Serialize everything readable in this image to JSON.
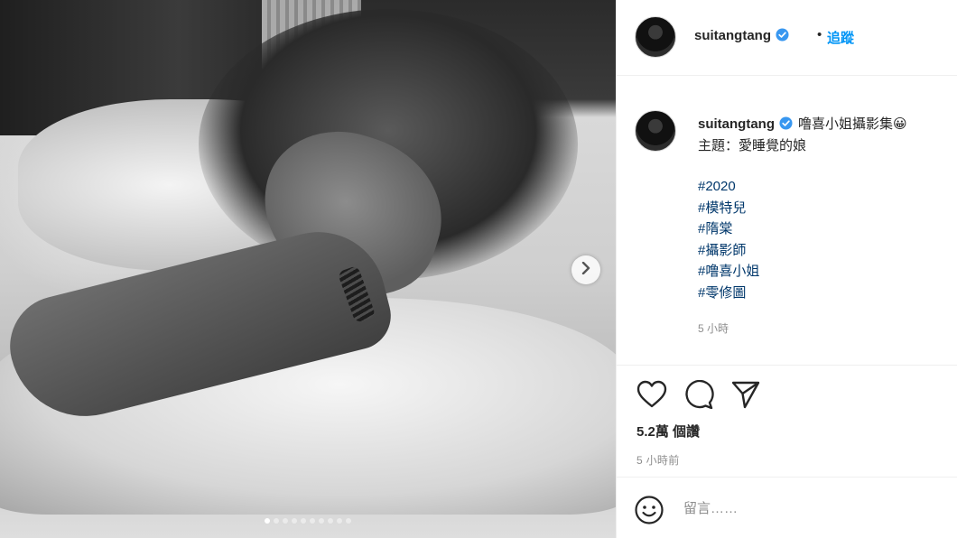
{
  "post": {
    "username": "suitangtang",
    "follow_separator": "•",
    "follow_label": "追蹤",
    "carousel_count": 10,
    "carousel_active_index": 0
  },
  "caption": {
    "username": "suitangtang",
    "title": "噜喜小姐攝影集😀",
    "theme": "主題：愛睡覺的娘",
    "hashtags": [
      "#2020",
      "#模特兒",
      "#隋棠",
      "#攝影師",
      "#噜喜小姐",
      "#零修圖"
    ],
    "time": "5 小時"
  },
  "engagement": {
    "likes": "5.2萬 個讚",
    "time_ago": "5 小時前"
  },
  "comment_box": {
    "placeholder": "留言……"
  },
  "icons": {
    "verified": "verified-badge-icon",
    "like": "heart-icon",
    "comment": "comment-bubble-icon",
    "share": "paper-plane-icon",
    "emoji": "smiley-icon",
    "next": "chevron-right-icon"
  },
  "colors": {
    "accent_blue": "#0095f6",
    "verified_blue": "#3897f0",
    "hashtag": "#00376b",
    "muted": "#8e8e8e",
    "text": "#262626"
  }
}
